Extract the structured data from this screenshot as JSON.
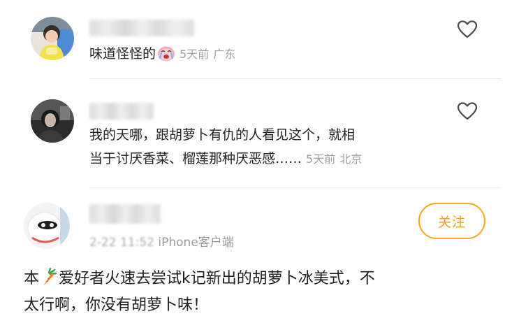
{
  "comments": [
    {
      "text": "味道怪怪的",
      "emoji_icon": "crying-face-icon",
      "time": "5天前",
      "location": "广东"
    },
    {
      "line1": "我的天哪，跟胡萝卜有仇的人看见这个，就相",
      "line2": "当于讨厌香菜、榴莲那种厌恶感……",
      "time": "5天前",
      "location": "北京"
    }
  ],
  "post": {
    "follow_label": "关注",
    "time": "2-22 11:52",
    "client": "iPhone客户端",
    "body_prefix": "本",
    "body_line1_rest": "爱好者火速去尝试k记新出的胡萝卜冰美式，不",
    "body_line2": "太行啊，你没有胡萝卜味！",
    "inline_icon": "carrot-icon"
  },
  "colors": {
    "accent": "#f5a623",
    "meta_gray": "#a0a0a0",
    "text": "#222222"
  }
}
